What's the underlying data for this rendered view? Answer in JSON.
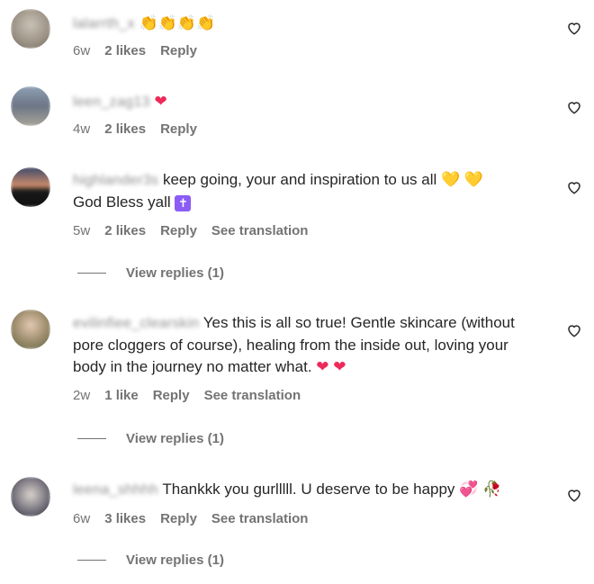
{
  "comments": [
    {
      "username": "lalarrth_x",
      "text": "",
      "emojis": "👏👏👏👏",
      "time": "6w",
      "likes": "2 likes",
      "reply": "Reply"
    },
    {
      "username": "leen_zag13",
      "text": "",
      "emojis": "❤",
      "time": "4w",
      "likes": "2 likes",
      "reply": "Reply"
    },
    {
      "username": "highlander3s",
      "text": "keep going, your and inspiration to us all",
      "emojis": "💛 💛",
      "text2": "God Bless yall",
      "cross": "✝",
      "time": "5w",
      "likes": "2 likes",
      "reply": "Reply",
      "see_translation": "See translation",
      "view_replies": "View replies (1)"
    },
    {
      "username": "evilinfiee_clearskin",
      "text": "Yes this is all so true! Gentle skincare (without pore cloggers of course), healing from the inside out, loving your body in the journey no matter what.",
      "emojis": "❤ ❤",
      "time": "2w",
      "likes": "1 like",
      "reply": "Reply",
      "see_translation": "See translation",
      "view_replies": "View replies (1)"
    },
    {
      "username": "leena_shhhh",
      "text": "Thankkk you gurlllll. U deserve to be happy",
      "emojis": "💞 🥀",
      "time": "6w",
      "likes": "3 likes",
      "reply": "Reply",
      "see_translation": "See translation",
      "view_replies": "View replies (1)"
    }
  ],
  "icons": {
    "heart": "heart-outline-icon"
  }
}
